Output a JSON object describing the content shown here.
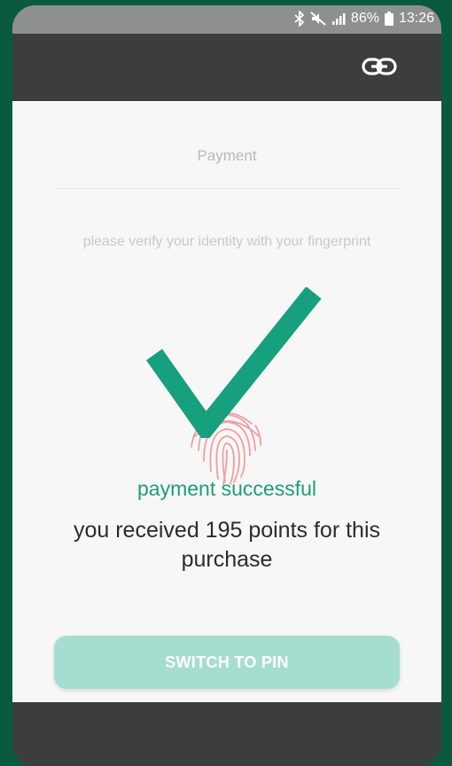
{
  "status_bar": {
    "battery_percent": "86%",
    "time": "13:26",
    "icons": [
      "bluetooth-icon",
      "mute-icon",
      "signal-icon",
      "battery-icon"
    ]
  },
  "app_bar": {
    "icon": "link-icon"
  },
  "payment": {
    "title": "Payment",
    "instruction": "please verify your identity with your fingerprint",
    "success_message": "payment successful",
    "points_message": "you received 195 points for this purchase",
    "switch_button_label": "SWITCH TO PIN"
  },
  "colors": {
    "accent": "#1c9e7c",
    "checkmark": "#17a07e",
    "button": "#a6ddd1",
    "fingerprint": "#f08f8f",
    "app_bar": "#3c3d3f",
    "status_bar": "#8e8f90",
    "background": "#0a5a40"
  }
}
